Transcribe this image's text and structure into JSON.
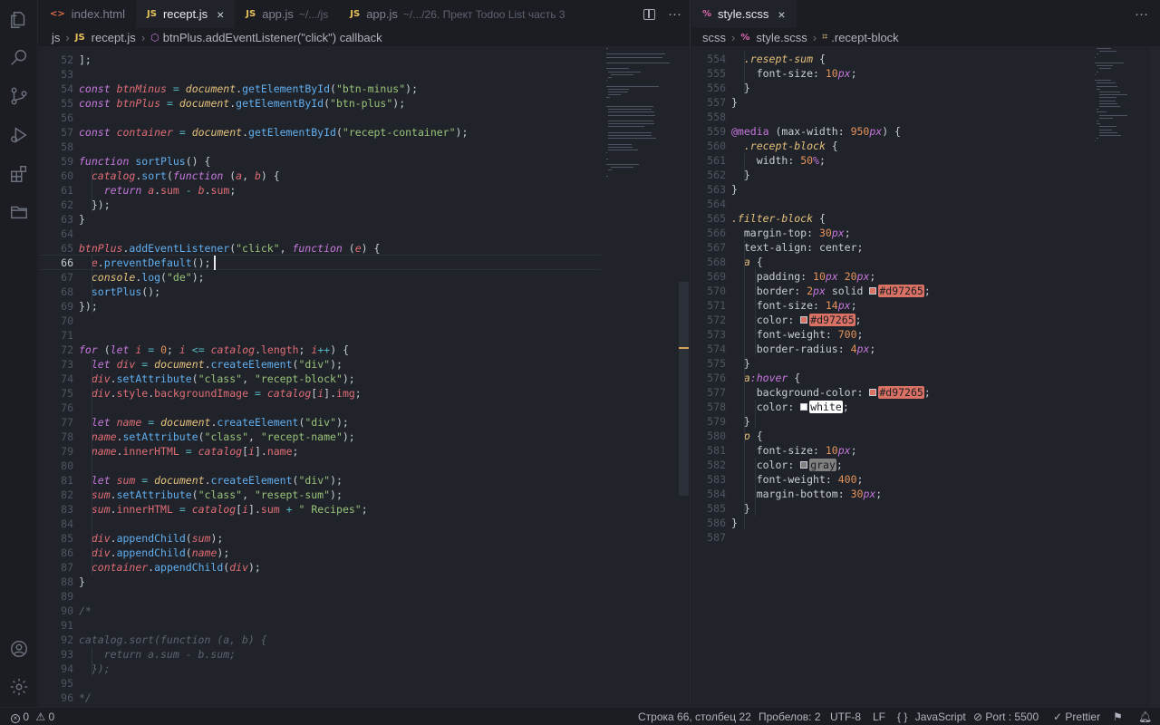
{
  "tabs_left": [
    {
      "icon": "<>",
      "label": "index.html",
      "hint": ""
    },
    {
      "icon": "JS",
      "label": "recept.js",
      "hint": ""
    },
    {
      "icon": "JS",
      "label": "app.js",
      "hint": "~/.../js"
    },
    {
      "icon": "JS",
      "label": "app.js",
      "hint": "~/.../26. Прект Todoo List часть 3"
    }
  ],
  "tabs_right": [
    {
      "icon": "%",
      "label": "style.scss"
    }
  ],
  "close_glyph": "×",
  "more_glyph": "···",
  "breadcrumb_left": [
    "js",
    "recept.js",
    "btnPlus.addEventListener(\"click\") callback"
  ],
  "breadcrumb_right": [
    "scss",
    "style.scss",
    ".recept-block"
  ],
  "left_lines": [
    {
      "n": "52",
      "code": "];"
    },
    {
      "n": "53",
      "code": ""
    },
    {
      "n": "54",
      "code": "const btnMinus = document.getElementById(\"btn-minus\");"
    },
    {
      "n": "55",
      "code": "const btnPlus = document.getElementById(\"btn-plus\");"
    },
    {
      "n": "56",
      "code": ""
    },
    {
      "n": "57",
      "code": "const container = document.getElementById(\"recept-container\");"
    },
    {
      "n": "58",
      "code": ""
    },
    {
      "n": "59",
      "code": "function sortPlus() {"
    },
    {
      "n": "60",
      "code": "  catalog.sort(function (a, b) {"
    },
    {
      "n": "61",
      "code": "    return a.sum - b.sum;"
    },
    {
      "n": "62",
      "code": "  });"
    },
    {
      "n": "63",
      "code": "}"
    },
    {
      "n": "64",
      "code": ""
    },
    {
      "n": "65",
      "code": "btnPlus.addEventListener(\"click\", function (e) {"
    },
    {
      "n": "66",
      "code": "  e.preventDefault();"
    },
    {
      "n": "67",
      "code": "  console.log(\"de\");"
    },
    {
      "n": "68",
      "code": "  sortPlus();"
    },
    {
      "n": "69",
      "code": "});"
    },
    {
      "n": "70",
      "code": ""
    },
    {
      "n": "71",
      "code": ""
    },
    {
      "n": "72",
      "code": "for (let i = 0; i <= catalog.length; i++) {"
    },
    {
      "n": "73",
      "code": "  let div = document.createElement(\"div\");"
    },
    {
      "n": "74",
      "code": "  div.setAttribute(\"class\", \"recept-block\");"
    },
    {
      "n": "75",
      "code": "  div.style.backgroundImage = catalog[i].img;"
    },
    {
      "n": "76",
      "code": ""
    },
    {
      "n": "77",
      "code": "  let name = document.createElement(\"div\");"
    },
    {
      "n": "78",
      "code": "  name.setAttribute(\"class\", \"recept-name\");"
    },
    {
      "n": "79",
      "code": "  name.innerHTML = catalog[i].name;"
    },
    {
      "n": "80",
      "code": ""
    },
    {
      "n": "81",
      "code": "  let sum = document.createElement(\"div\");"
    },
    {
      "n": "82",
      "code": "  sum.setAttribute(\"class\", \"resept-sum\");"
    },
    {
      "n": "83",
      "code": "  sum.innerHTML = catalog[i].sum + \" Recipes\";"
    },
    {
      "n": "84",
      "code": ""
    },
    {
      "n": "85",
      "code": "  div.appendChild(sum);"
    },
    {
      "n": "86",
      "code": "  div.appendChild(name);"
    },
    {
      "n": "87",
      "code": "  container.appendChild(div);"
    },
    {
      "n": "88",
      "code": "}"
    },
    {
      "n": "89",
      "code": ""
    },
    {
      "n": "90",
      "code": "/*"
    },
    {
      "n": "91",
      "code": ""
    },
    {
      "n": "92",
      "code": "catalog.sort(function (a, b) {"
    },
    {
      "n": "93",
      "code": "    return a.sum - b.sum;"
    },
    {
      "n": "94",
      "code": "  });"
    },
    {
      "n": "95",
      "code": ""
    },
    {
      "n": "96",
      "code": "*/"
    }
  ],
  "right_lines": [
    {
      "n": "554",
      "code": "  .resept-sum {"
    },
    {
      "n": "555",
      "code": "    font-size: 10px;"
    },
    {
      "n": "556",
      "code": "  }"
    },
    {
      "n": "557",
      "code": "}"
    },
    {
      "n": "558",
      "code": ""
    },
    {
      "n": "559",
      "code": "@media (max-width: 950px) {"
    },
    {
      "n": "560",
      "code": "  .recept-block {"
    },
    {
      "n": "561",
      "code": "    width: 50%;"
    },
    {
      "n": "562",
      "code": "  }"
    },
    {
      "n": "563",
      "code": "}"
    },
    {
      "n": "564",
      "code": ""
    },
    {
      "n": "565",
      "code": ".filter-block {"
    },
    {
      "n": "566",
      "code": "  margin-top: 30px;"
    },
    {
      "n": "567",
      "code": "  text-align: center;"
    },
    {
      "n": "568",
      "code": "  a {"
    },
    {
      "n": "569",
      "code": "    padding: 10px 20px;"
    },
    {
      "n": "570",
      "code": "    border: 2px solid #d97265;"
    },
    {
      "n": "571",
      "code": "    font-size: 14px;"
    },
    {
      "n": "572",
      "code": "    color: #d97265;"
    },
    {
      "n": "573",
      "code": "    font-weight: 700;"
    },
    {
      "n": "574",
      "code": "    border-radius: 4px;"
    },
    {
      "n": "575",
      "code": "  }"
    },
    {
      "n": "576",
      "code": "  a:hover {"
    },
    {
      "n": "577",
      "code": "    background-color: #d97265;"
    },
    {
      "n": "578",
      "code": "    color: white;"
    },
    {
      "n": "579",
      "code": "  }"
    },
    {
      "n": "580",
      "code": "  p {"
    },
    {
      "n": "581",
      "code": "    font-size: 10px;"
    },
    {
      "n": "582",
      "code": "    color: gray;"
    },
    {
      "n": "583",
      "code": "    font-weight: 400;"
    },
    {
      "n": "584",
      "code": "    margin-bottom: 30px;"
    },
    {
      "n": "585",
      "code": "  }"
    },
    {
      "n": "586",
      "code": "}"
    },
    {
      "n": "587",
      "code": ""
    }
  ],
  "current_line": "66",
  "status": {
    "errors": "0",
    "warnings": "0",
    "position": "Строка 66, столбец 22",
    "spaces": "Пробелов: 2",
    "encoding": "UTF-8",
    "eol": "LF",
    "language_glyph": "{ }",
    "language": "JavaScript",
    "port": "Port : 5500",
    "prettier": "Prettier"
  },
  "colors": {
    "accent": "#d97265",
    "keyword": "#c678dd",
    "function": "#61afef",
    "string": "#98c379",
    "number": "#e5935b",
    "editor_bg": "#20232a"
  },
  "icons": [
    "explorer-icon",
    "search-icon",
    "source-control-icon",
    "run-debug-icon",
    "extensions-icon",
    "folder-icon",
    "account-icon",
    "settings-gear-icon",
    "split-editor-icon",
    "more-actions-icon",
    "close-icon",
    "error-icon",
    "warning-icon",
    "port-icon",
    "check-icon",
    "feedback-icon",
    "bell-icon"
  ]
}
